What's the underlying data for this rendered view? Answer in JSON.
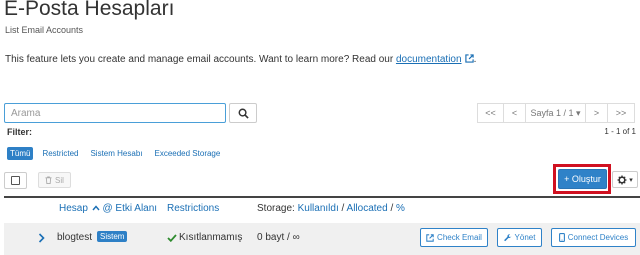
{
  "header": {
    "title": "E-Posta Hesapları",
    "subtitle": "List Email Accounts",
    "description": "This feature lets you create and manage email accounts. Want to learn more? Read our ",
    "doc_link": "documentation",
    "desc_end": "."
  },
  "search": {
    "placeholder": "Arama",
    "value": ""
  },
  "pagination": {
    "first": "<<",
    "prev": "<",
    "page_label": "Sayfa 1 / 1 ▾",
    "next": ">",
    "last": ">>"
  },
  "filter": {
    "label": "Filter:",
    "result_count": "1 - 1 of 1",
    "tabs": [
      "Tümü",
      "Restricted",
      "Sistem Hesabı",
      "Exceeded Storage"
    ],
    "active_tab": "Tümü"
  },
  "toolbar": {
    "delete_label": "Sil",
    "create_label": "+ Oluştur",
    "settings_caret": "▾"
  },
  "table": {
    "col_account": "Hesap",
    "col_at_domain": "@ Etki Alanı",
    "col_restrictions": "Restrictions",
    "col_storage_prefix": "Storage:",
    "col_storage_used": "Kullanıldı",
    "col_storage_sep1": "/",
    "col_storage_allocated": "Allocated",
    "col_storage_sep2": "/",
    "col_storage_percent": "%",
    "rows": [
      {
        "account": "blogtest",
        "badge": "Sistem",
        "restriction": "Kısıtlanmamış",
        "storage": "0 bayt / ∞",
        "check_email": "Check Email",
        "manage": "Yönet",
        "connect_devices": "Connect Devices"
      }
    ]
  },
  "colors": {
    "accent": "#2f82c8",
    "highlight_border": "#d01020",
    "restriction_check": "#2e8b2e"
  }
}
